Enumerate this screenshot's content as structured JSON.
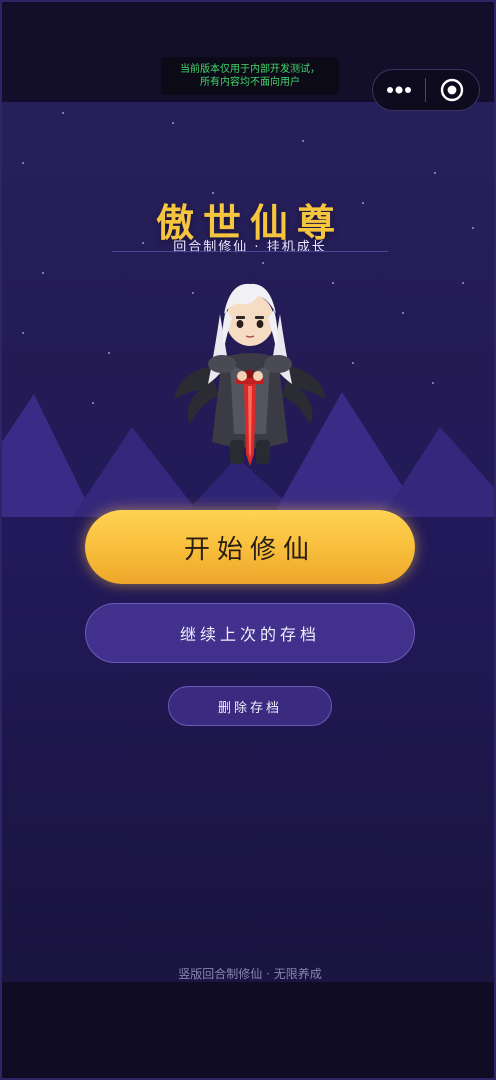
{
  "dev_notice": {
    "line1": "当前版本仅用于内部开发测试，",
    "line2": "所有内容均不面向用户"
  },
  "capsule": {
    "menu_icon": "more-dots-icon",
    "close_icon": "target-circle-icon"
  },
  "game": {
    "title": "傲世仙尊",
    "subtitle": "回合制修仙 · 挂机成长",
    "hero_icon": "swordsman-character"
  },
  "buttons": {
    "start": "开始修仙",
    "continue": "继续上次的存档",
    "delete": "删除存档"
  },
  "footer": {
    "text": "竖版回合制修仙 · 无限养成"
  },
  "colors": {
    "title": "#f6c53f",
    "start_button": "#f8bf3c",
    "secondary_button": "#41308c",
    "background": "#241b55"
  }
}
